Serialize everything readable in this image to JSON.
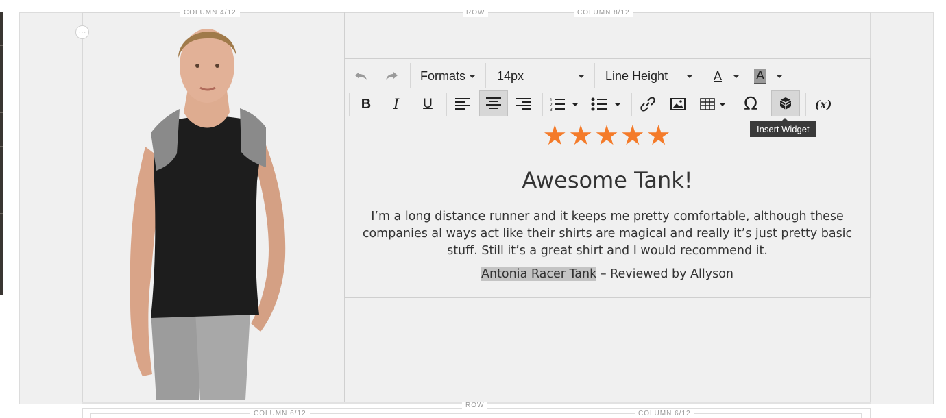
{
  "layout_tags": {
    "column_left": "COLUMN 4/12",
    "row_top": "ROW",
    "column_right": "COLUMN 8/12",
    "row_bottom": "ROW",
    "column_bottom_left": "COLUMN 6/12",
    "column_bottom_right": "COLUMN 6/12"
  },
  "more_handle": "···",
  "toolbar": {
    "undo_icon": "undo-icon",
    "redo_icon": "redo-icon",
    "formats_label": "Formats",
    "font_size_value": "14px",
    "line_height_label": "Line Height",
    "text_color_glyph": "A",
    "bg_color_glyph": "A",
    "bold_glyph": "B",
    "italic_glyph": "I",
    "underline_glyph": "U",
    "special_char_glyph": "Ω",
    "variable_glyph": "(x)"
  },
  "tooltip": {
    "text": "Insert Widget"
  },
  "review": {
    "stars": "★★★★★",
    "rating": 5,
    "star_color": "#f47b2a",
    "title": "Awesome Tank!",
    "body": "I’m a long distance runner and it keeps me pretty comfortable, although these companies al ways act like their shirts are magical and really it’s just pretty basic stuff. Still it’s a great shirt and I would recommend it.",
    "product_name": "Antonia Racer Tank",
    "byline_rest": " – Reviewed by Allyson"
  },
  "colors": {
    "accent_star": "#f47b2a",
    "tooltip_bg": "#3a3a3a",
    "stage_bg": "#f0f0f0"
  }
}
